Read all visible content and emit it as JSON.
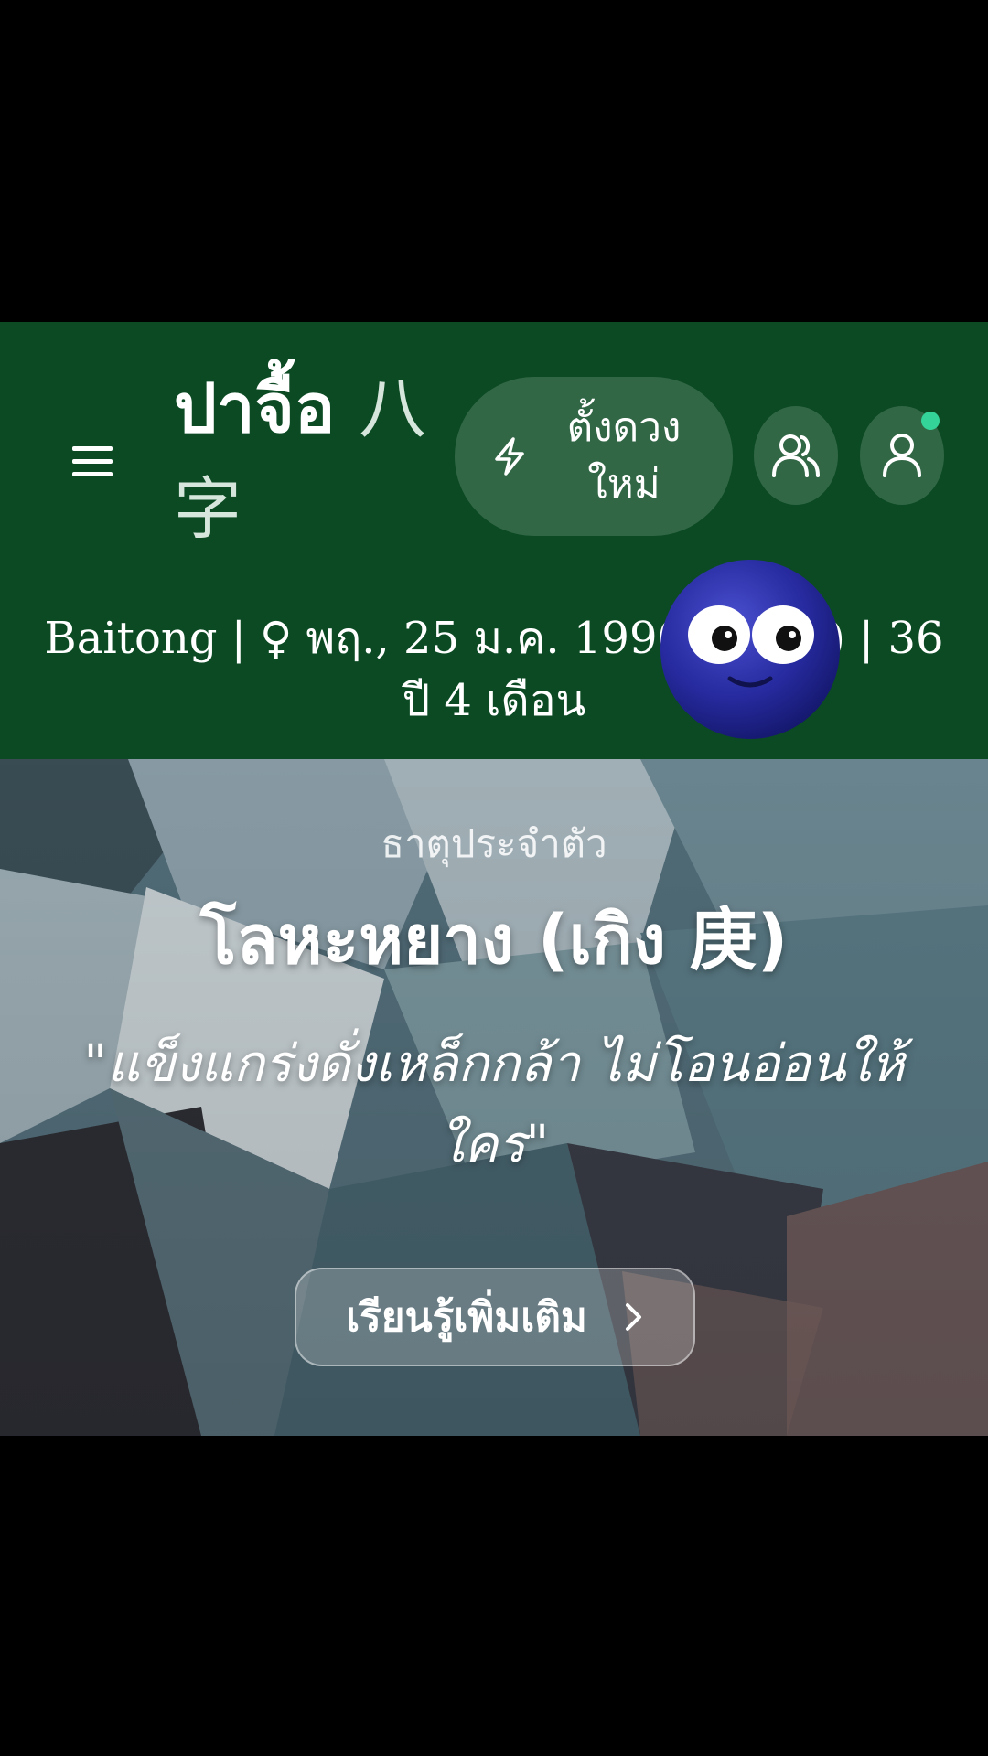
{
  "header": {
    "brand_thai": "ปาจื้อ",
    "brand_chinese_1": "八",
    "brand_chinese_2": "字",
    "new_chart_button": {
      "line1": "ตั้งดวง",
      "line2": "ใหม่",
      "icon": "lightning-icon"
    },
    "icons": {
      "menu": "menu-icon",
      "friends": "users-icon",
      "profile": "user-icon"
    },
    "colors": {
      "background": "#0b4a23",
      "online_indicator": "#34d399"
    },
    "profile_info_line1": "Baitong | ♀ พฤ., 25 ม.ค. 1990 (        ) | 36",
    "profile_info_line2": "ปี 4 เดือน"
  },
  "overlay": {
    "emoji": "googly-eyed-face"
  },
  "hero": {
    "eyebrow": "ธาตุประจำตัว",
    "element_title": "โลหะหยาง (เกิง 庚)",
    "quote": "\"แข็งแกร่งดั่งเหล็กกล้า ไม่โอนอ่อนให้ใคร\"",
    "learn_more_label": "เรียนรู้เพิ่มเติม",
    "learn_more_icon": "chevron-right-icon"
  }
}
